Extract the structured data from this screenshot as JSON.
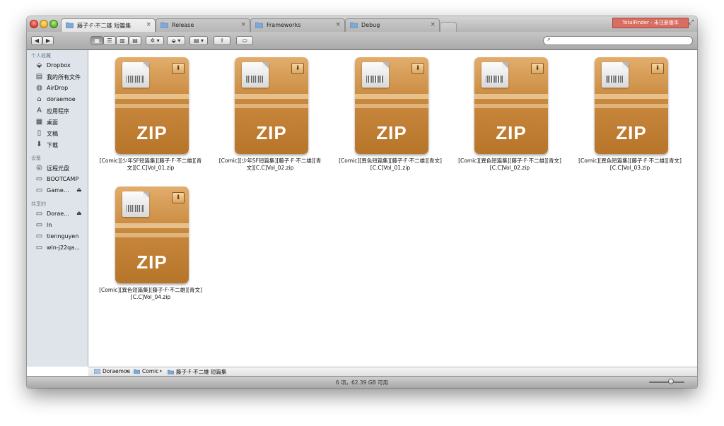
{
  "tabs": [
    {
      "label": "藤子·F·不二雄 短篇集",
      "active": true
    },
    {
      "label": "Release",
      "active": false
    },
    {
      "label": "Frameworks",
      "active": false
    },
    {
      "label": "Debug",
      "active": false
    }
  ],
  "tab_close_glyph": "×",
  "totalfinder_badge": "TotalFinder - 未注册版本",
  "toolbar": {
    "back_glyph": "◀",
    "forward_glyph": "▶",
    "view_icons": [
      "icon-view-icon",
      "list-view-icon",
      "column-view-icon",
      "coverflow-view-icon"
    ],
    "action_label": "✲ ▾",
    "dropbox_label": "⬙ ▾",
    "arrange_label": "▤ ▾",
    "share_label": "⇪",
    "tags_label": "⬭"
  },
  "search": {
    "placeholder": ""
  },
  "sidebar": {
    "favorites_header": "个人收藏",
    "favorites": [
      {
        "label": "Dropbox",
        "icon": "dropbox-icon",
        "glyph": "⬙"
      },
      {
        "label": "我的所有文件",
        "icon": "all-files-icon",
        "glyph": "▤"
      },
      {
        "label": "AirDrop",
        "icon": "airdrop-icon",
        "glyph": "◍"
      },
      {
        "label": "doraemoe",
        "icon": "home-icon",
        "glyph": "⌂"
      },
      {
        "label": "应用程序",
        "icon": "applications-icon",
        "glyph": "A"
      },
      {
        "label": "桌面",
        "icon": "desktop-icon",
        "glyph": "▦"
      },
      {
        "label": "文稿",
        "icon": "documents-icon",
        "glyph": "▯"
      },
      {
        "label": "下载",
        "icon": "downloads-icon",
        "glyph": "⬇"
      }
    ],
    "devices_header": "设备",
    "devices": [
      {
        "label": "远程光盘",
        "icon": "remote-disc-icon",
        "glyph": "◎",
        "eject": false
      },
      {
        "label": "BOOTCAMP",
        "icon": "drive-icon",
        "glyph": "▭",
        "eject": false
      },
      {
        "label": "Game…",
        "icon": "drive-icon",
        "glyph": "▭",
        "eject": true
      }
    ],
    "shared_header": "共享的",
    "shared": [
      {
        "label": "Dorae…",
        "icon": "computer-icon",
        "glyph": "▭",
        "eject": true
      },
      {
        "label": "ln",
        "icon": "computer-icon",
        "glyph": "▭",
        "eject": false
      },
      {
        "label": "tiennguyen",
        "icon": "computer-icon",
        "glyph": "▭",
        "eject": false
      },
      {
        "label": "win-j22qa…",
        "icon": "computer-icon",
        "glyph": "▭",
        "eject": false
      }
    ],
    "eject_glyph": "⏏"
  },
  "files": [
    {
      "name_line1": "[Comic][少年SF短篇集][藤子·F·不二雄][青",
      "name_line2": "文][C.C]Vol_01.zip"
    },
    {
      "name_line1": "[Comic][少年SF短篇集][藤子·F·不二雄][青",
      "name_line2": "文][C.C]Vol_02.zip"
    },
    {
      "name_line1": "[Comic][異色短篇集][藤子·F·不二雄][青文]",
      "name_line2": "[C.C]Vol_01.zip"
    },
    {
      "name_line1": "[Comic][異色短篇集][藤子·F·不二雄][青文]",
      "name_line2": "[C.C]Vol_02.zip"
    },
    {
      "name_line1": "[Comic][異色短篇集][藤子·F·不二雄][青文]",
      "name_line2": "[C.C]Vol_03.zip"
    },
    {
      "name_line1": "[Comic][異色短篇集][藤子·F·不二雄][青文]",
      "name_line2": "[C.C]Vol_04.zip"
    }
  ],
  "zip_label": "ZIP",
  "download_glyph": "⬇",
  "path": [
    {
      "label": "Doraemoe"
    },
    {
      "label": "Comic"
    },
    {
      "label": "藤子·F·不二雄 短篇集"
    }
  ],
  "path_sep": "▸",
  "status": "6 项，62.39 GB 可用",
  "colors": {
    "folder_blue": "#7fa8d4",
    "zip_brown": "#c8883d",
    "badge_red": "#d86d62"
  }
}
